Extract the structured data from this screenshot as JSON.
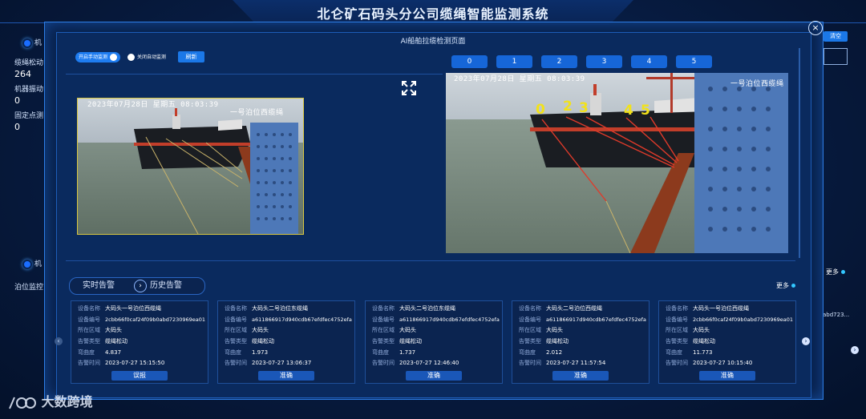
{
  "header": {
    "title": "北仑矿石码头分公司缆绳智能监测系统"
  },
  "left_panel": {
    "section1_label": "机",
    "items": [
      {
        "label": "缆绳松动",
        "value": "264"
      },
      {
        "label": "机器振动",
        "value": "0"
      },
      {
        "label": "固定点测",
        "value": "0"
      }
    ],
    "section2_label": "机",
    "berth_label": "泊位监控"
  },
  "right_panel": {
    "clear_label": "清空",
    "more_label": "更多",
    "partial_code": "abd723..."
  },
  "modal": {
    "title": "AI船舶拉缆检测页面",
    "manual_label": "开启手动监测",
    "auto_label": "关闭自动监测",
    "refresh_label": "刷新",
    "camera_buttons": [
      "0",
      "1",
      "2",
      "3",
      "4",
      "5"
    ],
    "left_cam": {
      "timestamp": "2023年07月28日  星期五  08:03:39",
      "location": "一号泊位西缆绳"
    },
    "right_cam": {
      "timestamp": "2023年07月28日  星期五  08:03:39",
      "location": "一号泊位西缆绳",
      "rope_numbers": [
        "0",
        "2",
        "3",
        "4",
        "5"
      ]
    },
    "tabs": {
      "realtime": "实时告警",
      "history": "历史告警"
    },
    "more_label": "更多",
    "field_labels": {
      "name": "设备名称",
      "code": "设备编号",
      "area": "所在区域",
      "type": "告警类型",
      "curvature": "弯曲度",
      "time": "告警时间"
    },
    "alerts": [
      {
        "name": "大码头一号泊位西缆绳",
        "code": "2cbb66f0caf24f09b0abd7230969ea01",
        "area": "大码头",
        "type": "缆绳松动",
        "curvature": "4.837",
        "time": "2023-07-27  15:15:50",
        "action": "误报"
      },
      {
        "name": "大码头二号泊位东缆绳",
        "code": "a611866917d940cdb67efdfec4752efa",
        "area": "大码头",
        "type": "缆绳松动",
        "curvature": "1.973",
        "time": "2023-07-27  13:06:37",
        "action": "准确"
      },
      {
        "name": "大码头二号泊位东缆绳",
        "code": "a611866917d940cdb67efdfec4752efa",
        "area": "大码头",
        "type": "缆绳松动",
        "curvature": "1.737",
        "time": "2023-07-27  12:46:40",
        "action": "准确"
      },
      {
        "name": "大码头二号泊位西缆绳",
        "code": "a611866917d940cdb67efdfec4752efa",
        "area": "大码头",
        "type": "缆绳松动",
        "curvature": "2.012",
        "time": "2023-07-27  11:57:54",
        "action": "准确"
      },
      {
        "name": "大码头一号泊位西缆绳",
        "code": "2cbb66f0caf24f09b0abd7230969ea01",
        "area": "大码头",
        "type": "缆绳松动",
        "curvature": "11.773",
        "time": "2023-07-27  10:15:40",
        "action": "准确"
      }
    ]
  },
  "watermark": {
    "text": "大数跨境"
  }
}
